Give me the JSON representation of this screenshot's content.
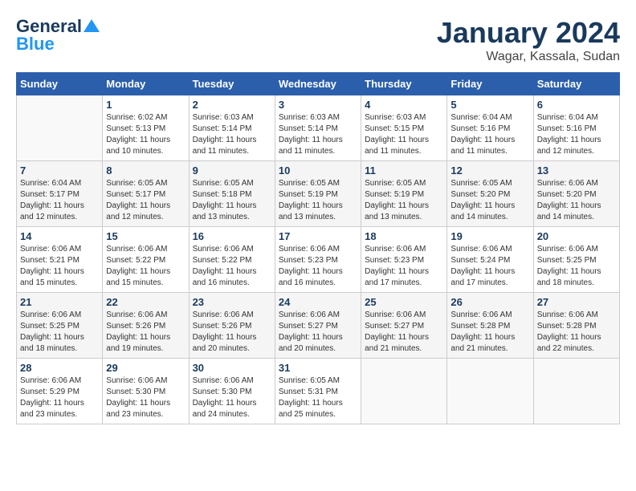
{
  "header": {
    "logo_general": "General",
    "logo_blue": "Blue",
    "month_title": "January 2024",
    "location": "Wagar, Kassala, Sudan"
  },
  "weekdays": [
    "Sunday",
    "Monday",
    "Tuesday",
    "Wednesday",
    "Thursday",
    "Friday",
    "Saturday"
  ],
  "weeks": [
    [
      {
        "day": "",
        "sunrise": "",
        "sunset": "",
        "daylight": ""
      },
      {
        "day": "1",
        "sunrise": "Sunrise: 6:02 AM",
        "sunset": "Sunset: 5:13 PM",
        "daylight": "Daylight: 11 hours and 10 minutes."
      },
      {
        "day": "2",
        "sunrise": "Sunrise: 6:03 AM",
        "sunset": "Sunset: 5:14 PM",
        "daylight": "Daylight: 11 hours and 11 minutes."
      },
      {
        "day": "3",
        "sunrise": "Sunrise: 6:03 AM",
        "sunset": "Sunset: 5:14 PM",
        "daylight": "Daylight: 11 hours and 11 minutes."
      },
      {
        "day": "4",
        "sunrise": "Sunrise: 6:03 AM",
        "sunset": "Sunset: 5:15 PM",
        "daylight": "Daylight: 11 hours and 11 minutes."
      },
      {
        "day": "5",
        "sunrise": "Sunrise: 6:04 AM",
        "sunset": "Sunset: 5:16 PM",
        "daylight": "Daylight: 11 hours and 11 minutes."
      },
      {
        "day": "6",
        "sunrise": "Sunrise: 6:04 AM",
        "sunset": "Sunset: 5:16 PM",
        "daylight": "Daylight: 11 hours and 12 minutes."
      }
    ],
    [
      {
        "day": "7",
        "sunrise": "Sunrise: 6:04 AM",
        "sunset": "Sunset: 5:17 PM",
        "daylight": "Daylight: 11 hours and 12 minutes."
      },
      {
        "day": "8",
        "sunrise": "Sunrise: 6:05 AM",
        "sunset": "Sunset: 5:17 PM",
        "daylight": "Daylight: 11 hours and 12 minutes."
      },
      {
        "day": "9",
        "sunrise": "Sunrise: 6:05 AM",
        "sunset": "Sunset: 5:18 PM",
        "daylight": "Daylight: 11 hours and 13 minutes."
      },
      {
        "day": "10",
        "sunrise": "Sunrise: 6:05 AM",
        "sunset": "Sunset: 5:19 PM",
        "daylight": "Daylight: 11 hours and 13 minutes."
      },
      {
        "day": "11",
        "sunrise": "Sunrise: 6:05 AM",
        "sunset": "Sunset: 5:19 PM",
        "daylight": "Daylight: 11 hours and 13 minutes."
      },
      {
        "day": "12",
        "sunrise": "Sunrise: 6:05 AM",
        "sunset": "Sunset: 5:20 PM",
        "daylight": "Daylight: 11 hours and 14 minutes."
      },
      {
        "day": "13",
        "sunrise": "Sunrise: 6:06 AM",
        "sunset": "Sunset: 5:20 PM",
        "daylight": "Daylight: 11 hours and 14 minutes."
      }
    ],
    [
      {
        "day": "14",
        "sunrise": "Sunrise: 6:06 AM",
        "sunset": "Sunset: 5:21 PM",
        "daylight": "Daylight: 11 hours and 15 minutes."
      },
      {
        "day": "15",
        "sunrise": "Sunrise: 6:06 AM",
        "sunset": "Sunset: 5:22 PM",
        "daylight": "Daylight: 11 hours and 15 minutes."
      },
      {
        "day": "16",
        "sunrise": "Sunrise: 6:06 AM",
        "sunset": "Sunset: 5:22 PM",
        "daylight": "Daylight: 11 hours and 16 minutes."
      },
      {
        "day": "17",
        "sunrise": "Sunrise: 6:06 AM",
        "sunset": "Sunset: 5:23 PM",
        "daylight": "Daylight: 11 hours and 16 minutes."
      },
      {
        "day": "18",
        "sunrise": "Sunrise: 6:06 AM",
        "sunset": "Sunset: 5:23 PM",
        "daylight": "Daylight: 11 hours and 17 minutes."
      },
      {
        "day": "19",
        "sunrise": "Sunrise: 6:06 AM",
        "sunset": "Sunset: 5:24 PM",
        "daylight": "Daylight: 11 hours and 17 minutes."
      },
      {
        "day": "20",
        "sunrise": "Sunrise: 6:06 AM",
        "sunset": "Sunset: 5:25 PM",
        "daylight": "Daylight: 11 hours and 18 minutes."
      }
    ],
    [
      {
        "day": "21",
        "sunrise": "Sunrise: 6:06 AM",
        "sunset": "Sunset: 5:25 PM",
        "daylight": "Daylight: 11 hours and 18 minutes."
      },
      {
        "day": "22",
        "sunrise": "Sunrise: 6:06 AM",
        "sunset": "Sunset: 5:26 PM",
        "daylight": "Daylight: 11 hours and 19 minutes."
      },
      {
        "day": "23",
        "sunrise": "Sunrise: 6:06 AM",
        "sunset": "Sunset: 5:26 PM",
        "daylight": "Daylight: 11 hours and 20 minutes."
      },
      {
        "day": "24",
        "sunrise": "Sunrise: 6:06 AM",
        "sunset": "Sunset: 5:27 PM",
        "daylight": "Daylight: 11 hours and 20 minutes."
      },
      {
        "day": "25",
        "sunrise": "Sunrise: 6:06 AM",
        "sunset": "Sunset: 5:27 PM",
        "daylight": "Daylight: 11 hours and 21 minutes."
      },
      {
        "day": "26",
        "sunrise": "Sunrise: 6:06 AM",
        "sunset": "Sunset: 5:28 PM",
        "daylight": "Daylight: 11 hours and 21 minutes."
      },
      {
        "day": "27",
        "sunrise": "Sunrise: 6:06 AM",
        "sunset": "Sunset: 5:28 PM",
        "daylight": "Daylight: 11 hours and 22 minutes."
      }
    ],
    [
      {
        "day": "28",
        "sunrise": "Sunrise: 6:06 AM",
        "sunset": "Sunset: 5:29 PM",
        "daylight": "Daylight: 11 hours and 23 minutes."
      },
      {
        "day": "29",
        "sunrise": "Sunrise: 6:06 AM",
        "sunset": "Sunset: 5:30 PM",
        "daylight": "Daylight: 11 hours and 23 minutes."
      },
      {
        "day": "30",
        "sunrise": "Sunrise: 6:06 AM",
        "sunset": "Sunset: 5:30 PM",
        "daylight": "Daylight: 11 hours and 24 minutes."
      },
      {
        "day": "31",
        "sunrise": "Sunrise: 6:05 AM",
        "sunset": "Sunset: 5:31 PM",
        "daylight": "Daylight: 11 hours and 25 minutes."
      },
      {
        "day": "",
        "sunrise": "",
        "sunset": "",
        "daylight": ""
      },
      {
        "day": "",
        "sunrise": "",
        "sunset": "",
        "daylight": ""
      },
      {
        "day": "",
        "sunrise": "",
        "sunset": "",
        "daylight": ""
      }
    ]
  ]
}
